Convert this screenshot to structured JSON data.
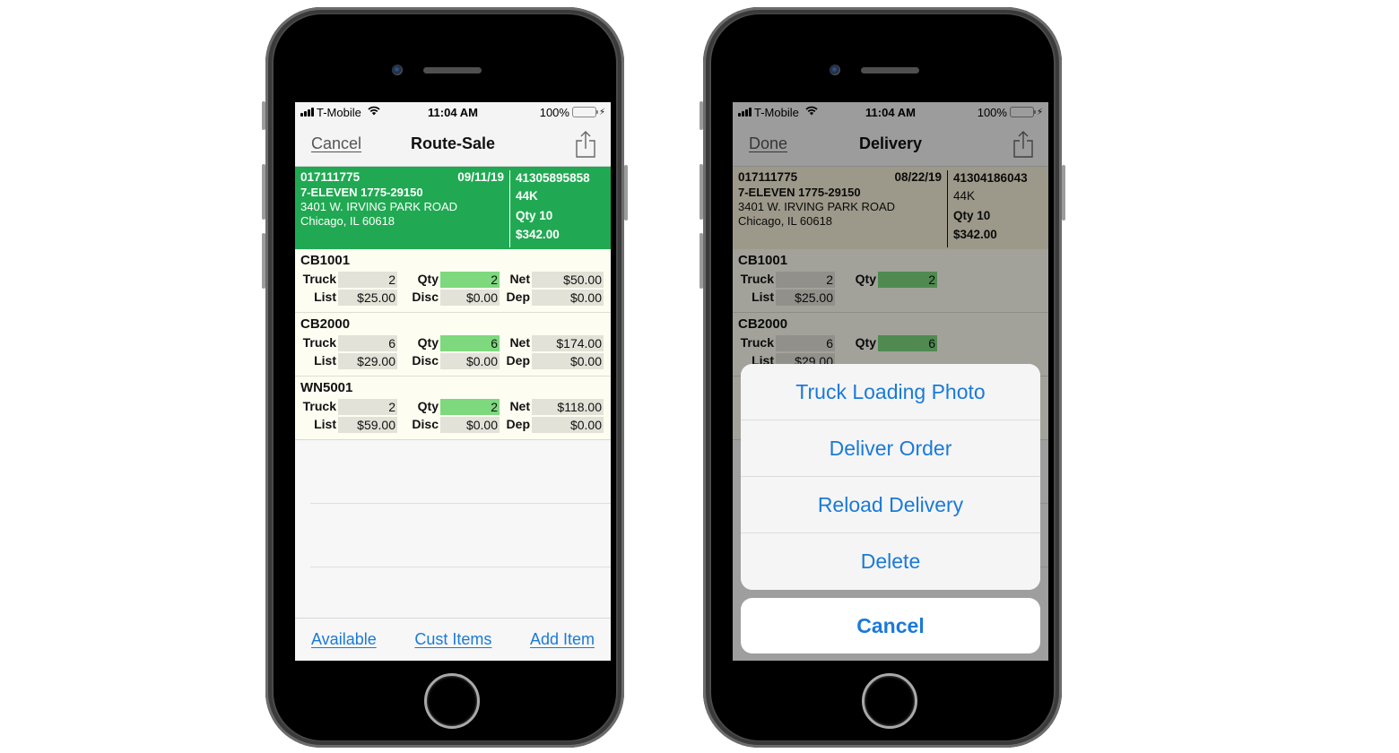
{
  "status_bar": {
    "carrier": "T-Mobile",
    "time": "11:04 AM",
    "battery": "100%",
    "battery_level": 1.0
  },
  "colors": {
    "header_green": "#20a952",
    "qty_green": "#7ed87d",
    "link_blue": "#1a7ad8",
    "item_bg": "#fdfdf2"
  },
  "left_screen": {
    "nav": {
      "left_button": "Cancel",
      "title": "Route-Sale",
      "share_icon": "share-icon"
    },
    "order": {
      "account": "017111775",
      "date": "09/11/19",
      "name": "7-ELEVEN 1775-29150",
      "address": "3401 W. IRVING PARK ROAD",
      "city": "Chicago, IL  60618",
      "order_number": "41305895858",
      "code": "44K",
      "qty": "Qty 10",
      "total": "$342.00"
    },
    "labels": {
      "truck": "Truck",
      "qty": "Qty",
      "net": "Net",
      "list": "List",
      "disc": "Disc",
      "dep": "Dep"
    },
    "items": [
      {
        "sku": "CB1001",
        "truck": "2",
        "qty": "2",
        "net": "$50.00",
        "list": "$25.00",
        "disc": "$0.00",
        "dep": "$0.00"
      },
      {
        "sku": "CB2000",
        "truck": "6",
        "qty": "6",
        "net": "$174.00",
        "list": "$29.00",
        "disc": "$0.00",
        "dep": "$0.00"
      },
      {
        "sku": "WN5001",
        "truck": "2",
        "qty": "2",
        "net": "$118.00",
        "list": "$59.00",
        "disc": "$0.00",
        "dep": "$0.00"
      }
    ],
    "toolbar": {
      "available": "Available",
      "cust_items": "Cust Items",
      "add_item": "Add Item"
    }
  },
  "right_screen": {
    "nav": {
      "left_button": "Done",
      "title": "Delivery",
      "share_icon": "share-icon"
    },
    "order": {
      "account": "017111775",
      "date": "08/22/19",
      "name": "7-ELEVEN 1775-29150",
      "address": "3401 W. IRVING PARK ROAD",
      "city": "Chicago, IL  60618",
      "order_number": "41304186043",
      "code": "44K",
      "qty": "Qty 10",
      "total": "$342.00"
    },
    "labels": {
      "truck": "Truck",
      "qty": "Qty",
      "list": "List"
    },
    "items": [
      {
        "sku": "CB1001",
        "truck": "2",
        "qty": "2",
        "list": "$25.00"
      },
      {
        "sku": "CB2000",
        "truck": "6",
        "qty": "6",
        "list": "$29.00"
      }
    ],
    "action_sheet": {
      "options": [
        "Truck Loading Photo",
        "Deliver Order",
        "Reload Delivery",
        "Delete"
      ],
      "cancel": "Cancel"
    }
  }
}
